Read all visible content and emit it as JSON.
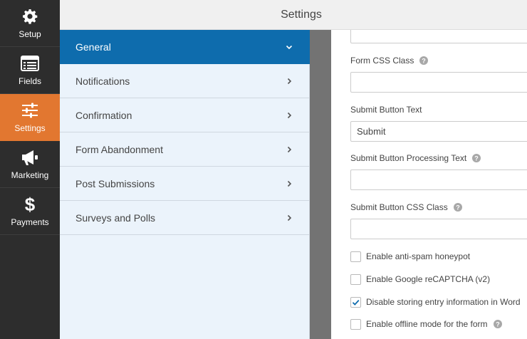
{
  "window": {
    "title": "Settings"
  },
  "rail": {
    "items": [
      {
        "label": "Setup",
        "icon": "gear-icon",
        "active": false
      },
      {
        "label": "Fields",
        "icon": "list-icon",
        "active": false
      },
      {
        "label": "Settings",
        "icon": "sliders-icon",
        "active": true
      },
      {
        "label": "Marketing",
        "icon": "megaphone-icon",
        "active": false
      },
      {
        "label": "Payments",
        "icon": "dollar-icon",
        "active": false
      }
    ]
  },
  "sections": {
    "items": [
      {
        "label": "General",
        "active": true,
        "expanded": true
      },
      {
        "label": "Notifications",
        "active": false
      },
      {
        "label": "Confirmation",
        "active": false
      },
      {
        "label": "Form Abandonment",
        "active": false
      },
      {
        "label": "Post Submissions",
        "active": false
      },
      {
        "label": "Surveys and Polls",
        "active": false
      }
    ]
  },
  "form": {
    "top_field": {
      "value": ""
    },
    "css_class": {
      "label": "Form CSS Class",
      "value": ""
    },
    "submit_text": {
      "label": "Submit Button Text",
      "value": "Submit"
    },
    "processing_text": {
      "label": "Submit Button Processing Text",
      "value": ""
    },
    "button_css_class": {
      "label": "Submit Button CSS Class",
      "value": ""
    },
    "checkboxes": [
      {
        "label": "Enable anti-spam honeypot",
        "checked": false
      },
      {
        "label": "Enable Google reCAPTCHA (v2)",
        "checked": false
      },
      {
        "label": "Disable storing entry information in Word",
        "checked": true
      },
      {
        "label": "Enable offline mode for the form",
        "checked": false
      }
    ]
  },
  "colors": {
    "rail_bg": "#2d2d2d",
    "rail_active": "#e27730",
    "section_bg": "#ebf3fb",
    "section_active": "#0e6cad",
    "gutter": "#737373",
    "check_accent": "#0e6cad"
  }
}
